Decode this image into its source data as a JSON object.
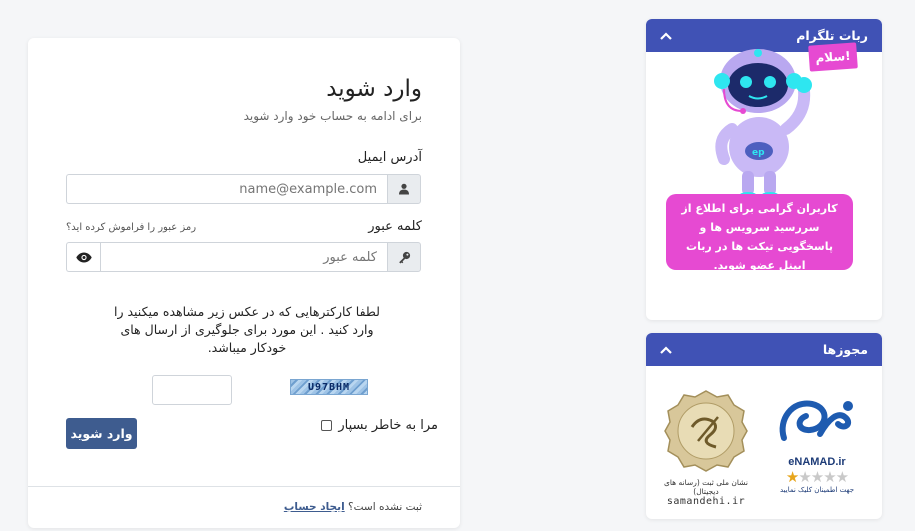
{
  "login": {
    "title": "وارد شوید",
    "subtitle": "برای ادامه به حساب خود وارد شوید",
    "email_label": "آدرس ایمیل",
    "email_placeholder": "name@example.com",
    "password_label": "کلمه عبور",
    "forgot_password": "رمز عبور را فراموش کرده اید؟",
    "password_placeholder": "کلمه عبور",
    "captcha_instructions": "لطفا کارکترهایی که در عکس زیر مشاهده میکنید را وارد کنید . این مورد برای جلوگیری از ارسال های خودکار میباشد.",
    "captcha_code": "U97BHM",
    "remember_me": "مرا به خاطر بسپار",
    "submit_label": "وارد شوید",
    "not_registered": "ثبت نشده است؟",
    "create_account": "ایجاد حساب"
  },
  "sidebar": {
    "telegram": {
      "title": "ربات تلگرام",
      "bubble": "سلام!",
      "promo": "کاربران گرامی برای اطلاع از سررسید سرویس ها و پاسخگویی تیکت ها در ربات ایپنل عضو شوید."
    },
    "licenses": {
      "title": "مجوزها",
      "enamad_title": "eNAMAD.ir",
      "enamad_rating": 1,
      "enamad_max": 5,
      "enamad_caption": "جهت اطمینان کلیک نمایید",
      "samandehi_caption": "نشان ملی ثبت (رسانه های دیجیتال)",
      "samandehi_url": "samandehi.ir"
    }
  },
  "colors": {
    "primary_button": "#3e5c8f",
    "panel_header": "#4052b5",
    "promo_pink": "#e64ad2"
  }
}
